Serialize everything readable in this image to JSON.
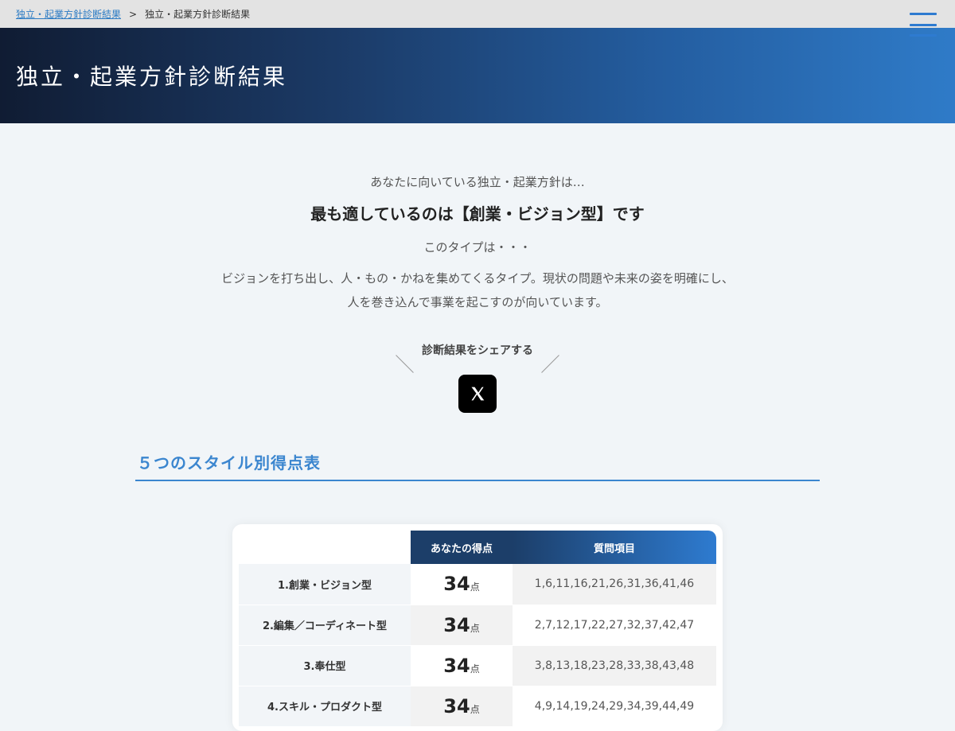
{
  "breadcrumb": {
    "link": "独立・起業方針診断結果",
    "separator": ">",
    "current": "独立・起業方針診断結果"
  },
  "hero": {
    "title": "独立・起業方針診断結果"
  },
  "result": {
    "lead": "あなたに向いている独立・起業方針は…",
    "main": "最も適しているのは【創業・ビジョン型】です",
    "sub": "このタイプは・・・",
    "desc_line1": "ビジョンを打ち出し、人・もの・かねを集めてくるタイプ。現状の問題や未来の姿を明確にし、",
    "desc_line2": "人を巻き込んで事業を起こすのが向いています。"
  },
  "share": {
    "label": "診断結果をシェアする",
    "button_icon": "x-logo-icon"
  },
  "section": {
    "title": "５つのスタイル別得点表"
  },
  "table": {
    "headers": {
      "score": "あなたの得点",
      "questions": "質問項目"
    },
    "unit": "点",
    "rows": [
      {
        "name": "1.創業・ビジョン型",
        "score": "34",
        "questions": "1,6,11,16,21,26,31,36,41,46"
      },
      {
        "name": "2.編集／コーディネート型",
        "score": "34",
        "questions": "2,7,12,17,22,27,32,37,42,47"
      },
      {
        "name": "3.奉仕型",
        "score": "34",
        "questions": "3,8,13,18,23,28,33,38,43,48"
      },
      {
        "name": "4.スキル・プロダクト型",
        "score": "34",
        "questions": "4,9,14,19,24,29,34,39,44,49"
      }
    ]
  },
  "colors": {
    "accent": "#3b86cf",
    "hero_dark": "#101c33",
    "hero_light": "#2f7bc8"
  }
}
